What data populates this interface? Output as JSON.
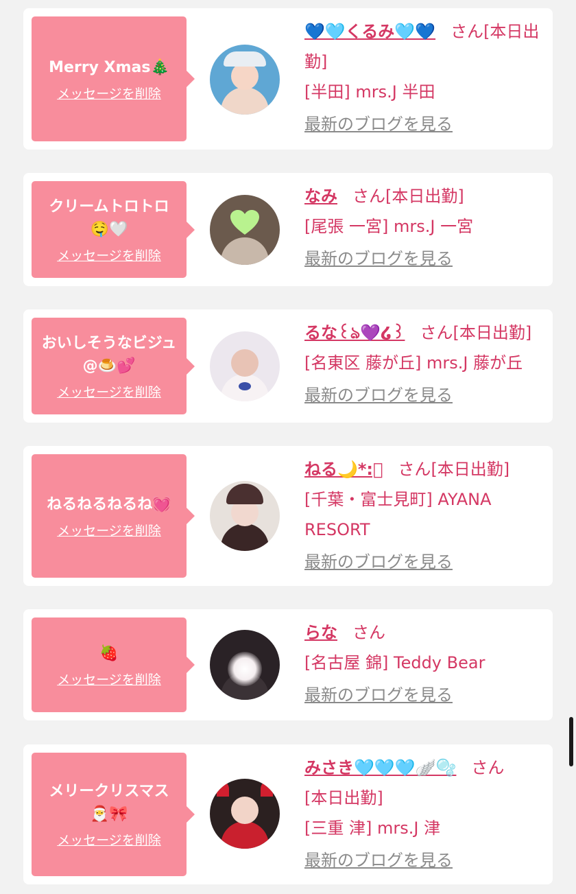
{
  "cards": [
    {
      "message": "Merry Xmas🎄",
      "delete_label": "メッセージを削除",
      "name": "💙🩵くるみ🩵💙",
      "suffix": "さん",
      "status": "[本日出勤]",
      "shop": "[半田] mrs.J 半田",
      "blog_label": "最新のブログを見る"
    },
    {
      "message": "クリームトロトロ🤤🤍",
      "delete_label": "メッセージを削除",
      "name": "なみ",
      "suffix": "さん",
      "status": "[本日出勤]",
      "shop": "[尾張 一宮] mrs.J 一宮",
      "blog_label": "最新のブログを見る"
    },
    {
      "message": "おいしそうなビジュ@🍮💕",
      "delete_label": "メッセージを削除",
      "name": "るな꒰ঌ💜໒꒱",
      "suffix": "さん",
      "status": "[本日出勤]",
      "shop": "[名東区 藤が丘] mrs.J 藤が丘",
      "blog_label": "最新のブログを見る"
    },
    {
      "message": "ねるねるねるね💓",
      "delete_label": "メッセージを削除",
      "name": "ねる🌙*:ﾟ",
      "suffix": "さん",
      "status": "[本日出勤]",
      "shop": "[千葉・富士見町] AYANA RESORT",
      "blog_label": "最新のブログを見る"
    },
    {
      "message": "🍓",
      "delete_label": "メッセージを削除",
      "name": "らな",
      "suffix": "さん",
      "status": "",
      "shop": "[名古屋 錦] Teddy Bear",
      "blog_label": "最新のブログを見る"
    },
    {
      "message": "メリークリスマス🎅🎀",
      "delete_label": "メッセージを削除",
      "name": "みさき🩵🩵🩵🪽🫧",
      "suffix": "さん",
      "status": "[本日出勤]",
      "shop": "[三重 津] mrs.J 津",
      "blog_label": "最新のブログを見る"
    }
  ]
}
